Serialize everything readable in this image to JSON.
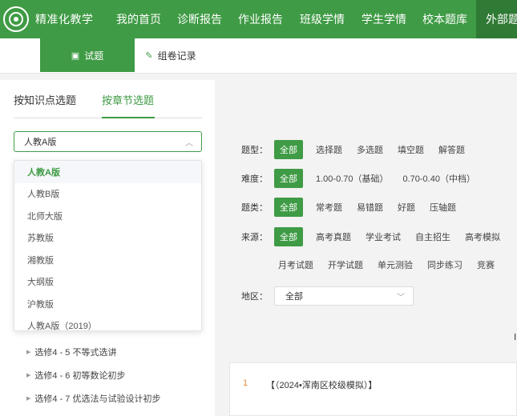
{
  "app": {
    "title": "精准化教学"
  },
  "nav": {
    "items": [
      "我的首页",
      "诊断报告",
      "作业报告",
      "班级学情",
      "学生学情",
      "校本题库"
    ],
    "active": "外部题"
  },
  "subnav": {
    "tab_active": "试题",
    "tab_inactive": "组卷记录"
  },
  "left": {
    "tab_knowledge": "按知识点选题",
    "tab_chapter": "按章节选题",
    "select_value": "人教A版",
    "dropdown_options": [
      "人教A版",
      "人教B版",
      "北师大版",
      "苏教版",
      "湘教版",
      "大纲版",
      "沪教版",
      "人教A版（2019）"
    ],
    "tree_items": [
      "选修4 - 5 不等式选讲",
      "选修4 - 6 初等数论初步",
      "选修4 - 7 优选法与试验设计初步"
    ]
  },
  "filters": {
    "type_label": "题型：",
    "type_options": [
      "全部",
      "选择题",
      "多选题",
      "填空题",
      "解答题"
    ],
    "difficulty_label": "难度：",
    "difficulty_options": [
      "全部",
      "1.00-0.70（基础）",
      "0.70-0.40（中档）"
    ],
    "category_label": "题类：",
    "category_options": [
      "全部",
      "常考题",
      "易错题",
      "好题",
      "压轴题"
    ],
    "source_label": "来源：",
    "source_options": [
      "全部",
      "高考真题",
      "学业考试",
      "自主招生",
      "高考模拟"
    ],
    "source_options_row2": [
      "月考试题",
      "开学试题",
      "单元测验",
      "同步练习",
      "竞赛"
    ],
    "region_label": "地区：",
    "region_value": "全部"
  },
  "question": {
    "number": "1",
    "title": "【（2024•浑南区校级模拟）】"
  },
  "right_edge_char": "Ⅰ"
}
